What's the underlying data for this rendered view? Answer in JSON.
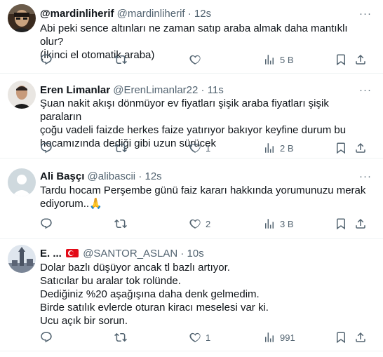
{
  "tweets": [
    {
      "name": "@mardinliherif",
      "handle": "@mardinliherif",
      "time": "12s",
      "lines": [
        "Abi peki sence altınları ne zaman satıp araba almak daha mantıklı olur?",
        "(İkinci el otomatik araba)"
      ],
      "likes": "",
      "views": "5 B"
    },
    {
      "name": "Eren Limanlar",
      "handle": "@ErenLimanlar22",
      "time": "11s",
      "lines": [
        "Şuan nakit akışı dönmüyor ev fiyatları şişik araba fiyatları şişik paraların",
        "çoğu vadeli faizde herkes faize yatırıyor bakıyor keyfine durum bu",
        "hocamızında dediği gibi uzun sürücek"
      ],
      "likes": "1",
      "views": "2 B"
    },
    {
      "name": "Ali Başçı",
      "handle": "@alibascii",
      "time": "12s",
      "lines": [
        "Tardu hocam Perşembe günü faiz kararı hakkında yorumunuzu merak",
        "ediyorum..🙏"
      ],
      "likes": "2",
      "views": "3 B"
    },
    {
      "name": "E. ...",
      "handle": "@SANTOR_ASLAN",
      "time": "10s",
      "lines": [
        "Dolar bazlı düşüyor ancak tl bazlı artıyor.",
        "Satıcılar bu aralar tok rolünde.",
        "Dediğiniz %20 aşağışına daha denk gelmedim.",
        "Birde satılık evlerde oturan kiracı meselesi var ki.",
        "Ucu açık bir sorun."
      ],
      "likes": "1",
      "views": "991"
    }
  ],
  "separator": "·",
  "more_glyph": "···",
  "icons": [
    "reply-icon",
    "retweet-icon",
    "like-icon",
    "views-icon",
    "bookmark-icon",
    "share-icon",
    "more-icon",
    "turkish-flag-icon"
  ],
  "colors": {
    "text": "#0f1419",
    "secondary": "#536471",
    "divider": "#eff3f4"
  }
}
